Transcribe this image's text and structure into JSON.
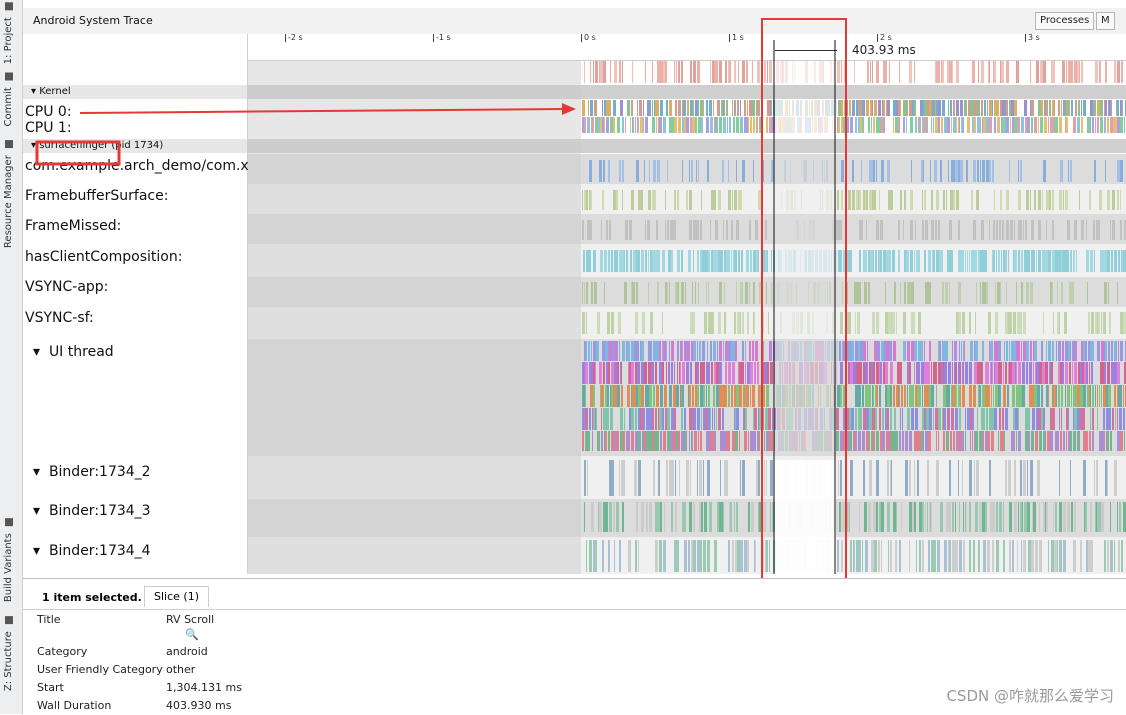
{
  "left_strip": {
    "tabs": [
      {
        "label": "1: Project",
        "icon": "folder-icon"
      },
      {
        "label": "Commit",
        "icon": "commit-icon"
      },
      {
        "label": "Resource Manager",
        "icon": "resource-icon"
      },
      {
        "label": "Build Variants",
        "icon": "build-variants-icon"
      },
      {
        "label": "Z: Structure",
        "icon": "structure-icon"
      }
    ]
  },
  "header": {
    "title": "Android System Trace",
    "buttons": [
      "Processes",
      "M"
    ]
  },
  "ruler": {
    "ticks": [
      "-2 s",
      "-1 s",
      "0 s",
      "1 s",
      "2 s",
      "3 s"
    ],
    "selection_duration": "403.93 ms"
  },
  "groups": {
    "kernel": "Kernel",
    "process": "surfaceflinger (pid 1734)"
  },
  "tracks": [
    "CPU 0:",
    "CPU 1:",
    "com.example.arch_demo/com.x",
    "FramebufferSurface:",
    "FrameMissed:",
    "hasClientComposition:",
    "VSYNC-app:",
    "VSYNC-sf:",
    "UI thread",
    "Binder:1734_2",
    "Binder:1734_3",
    "Binder:1734_4"
  ],
  "bottom": {
    "selected_text": "1 item selected.",
    "tab": "Slice (1)",
    "details": [
      {
        "key": "Title",
        "value": "RV Scroll"
      },
      {
        "key": "Category",
        "value": "android"
      },
      {
        "key": "User Friendly Category",
        "value": "other"
      },
      {
        "key": "Start",
        "value": "1,304.131 ms"
      },
      {
        "key": "Wall Duration",
        "value": "403.930 ms"
      }
    ]
  },
  "watermark": "CSDN @咋就那么爱学习",
  "colors": {
    "annotation_red": "#e53935",
    "track_grey": "#d9d9d9",
    "header_bg": "#f2f2f2"
  }
}
